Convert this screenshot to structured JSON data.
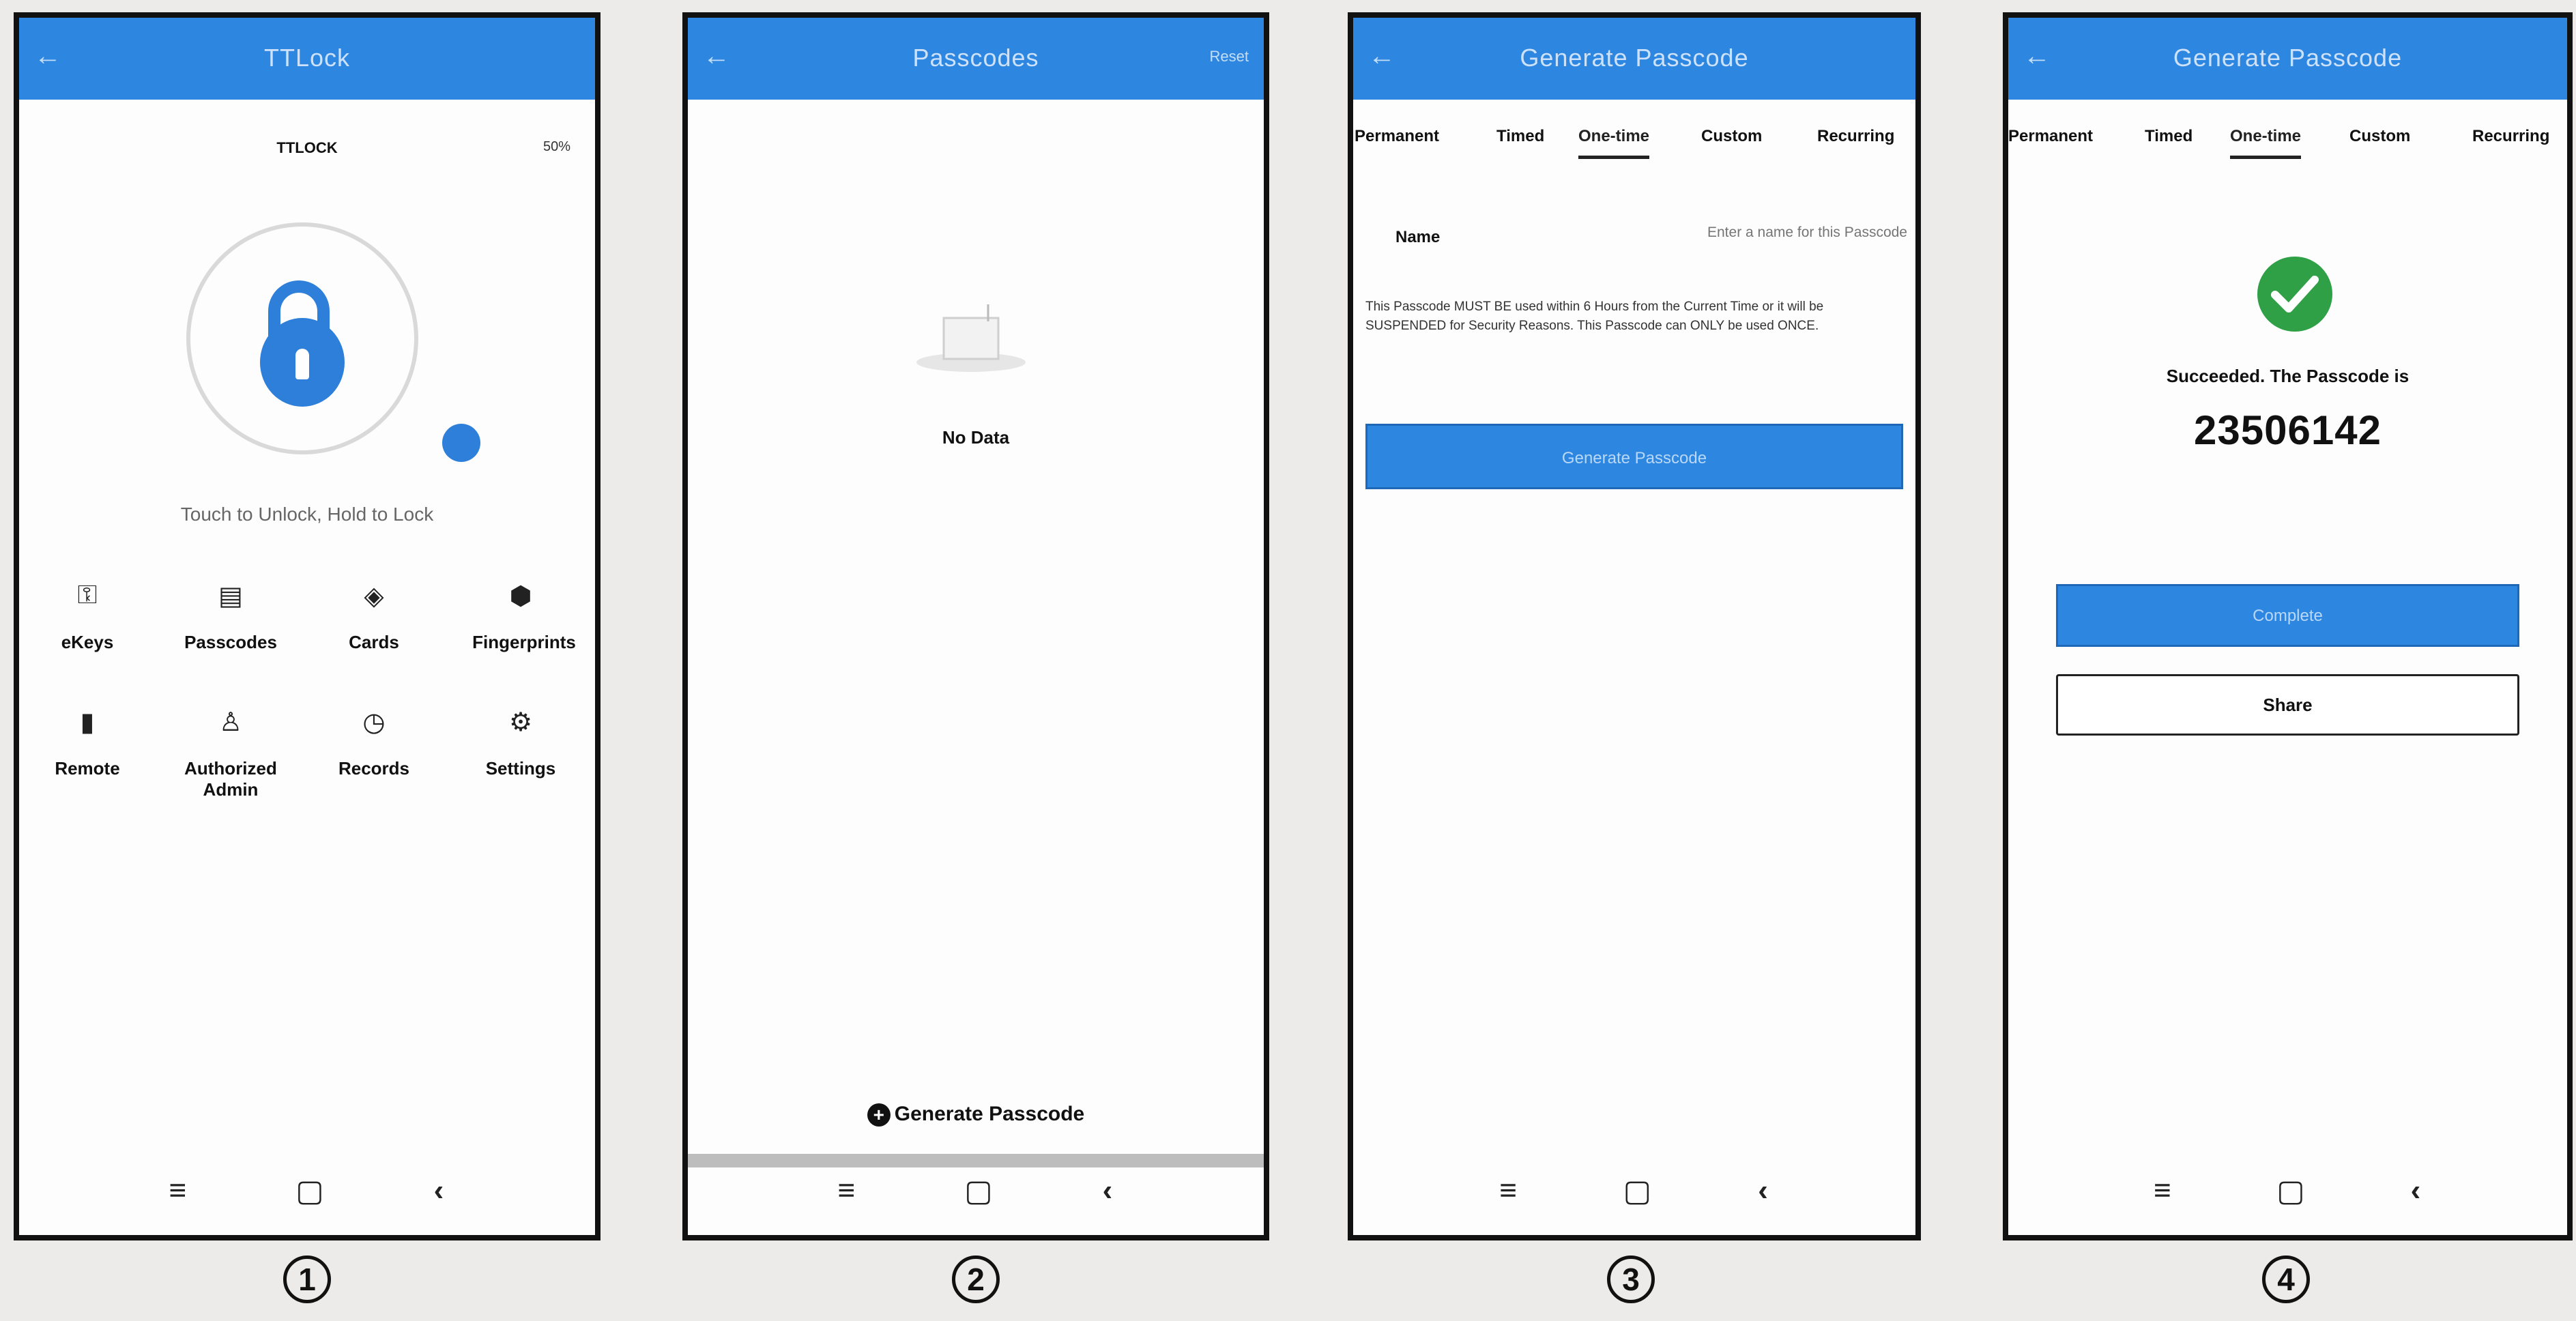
{
  "screens": [
    {
      "appbar_title": "TTLock",
      "lock_name": "TTLOCK",
      "battery": "50%",
      "hint": "Touch to Unlock, Hold to Lock",
      "grid": [
        {
          "icon": "ekey-icon",
          "glyph": "⚿",
          "label": "eKeys"
        },
        {
          "icon": "passcode-icon",
          "glyph": "▤",
          "label": "Passcodes"
        },
        {
          "icon": "card-icon",
          "glyph": "◈",
          "label": "Cards"
        },
        {
          "icon": "fingerprint-icon",
          "glyph": "⬢",
          "label": "Fingerprints"
        },
        {
          "icon": "remote-icon",
          "glyph": "▮",
          "label": "Remote"
        },
        {
          "icon": "admin-icon",
          "glyph": "♙",
          "label": "Authorized Admin"
        },
        {
          "icon": "records-icon",
          "glyph": "◷",
          "label": "Records"
        },
        {
          "icon": "settings-icon",
          "glyph": "⚙",
          "label": "Settings"
        }
      ],
      "step": "1"
    },
    {
      "appbar_title": "Passcodes",
      "reset": "Reset",
      "empty_text": "No Data",
      "generate_link": "Generate Passcode",
      "step": "2"
    },
    {
      "appbar_title": "Generate Passcode",
      "tabs": [
        "Permanent",
        "Timed",
        "One-time",
        "Custom",
        "Recurring"
      ],
      "active_tab": "One-time",
      "name_label": "Name",
      "name_placeholder": "Enter a name for this Passcode",
      "notice": "This Passcode MUST BE used within 6 Hours from the Current Time or it will be SUSPENDED for Security Reasons. This Passcode can ONLY be used ONCE.",
      "button": "Generate Passcode",
      "step": "3"
    },
    {
      "appbar_title": "Generate Passcode",
      "tabs": [
        "Permanent",
        "Timed",
        "One-time",
        "Custom",
        "Recurring"
      ],
      "active_tab": "One-time",
      "success_text": "Succeeded. The Passcode is",
      "passcode": "23506142",
      "complete_button": "Complete",
      "share_button": "Share",
      "step": "4"
    }
  ],
  "navbar": {
    "menu": "≡",
    "home": "▢",
    "back": "‹"
  },
  "colors": {
    "primary": "#2d86e0",
    "success": "#2fa046"
  }
}
